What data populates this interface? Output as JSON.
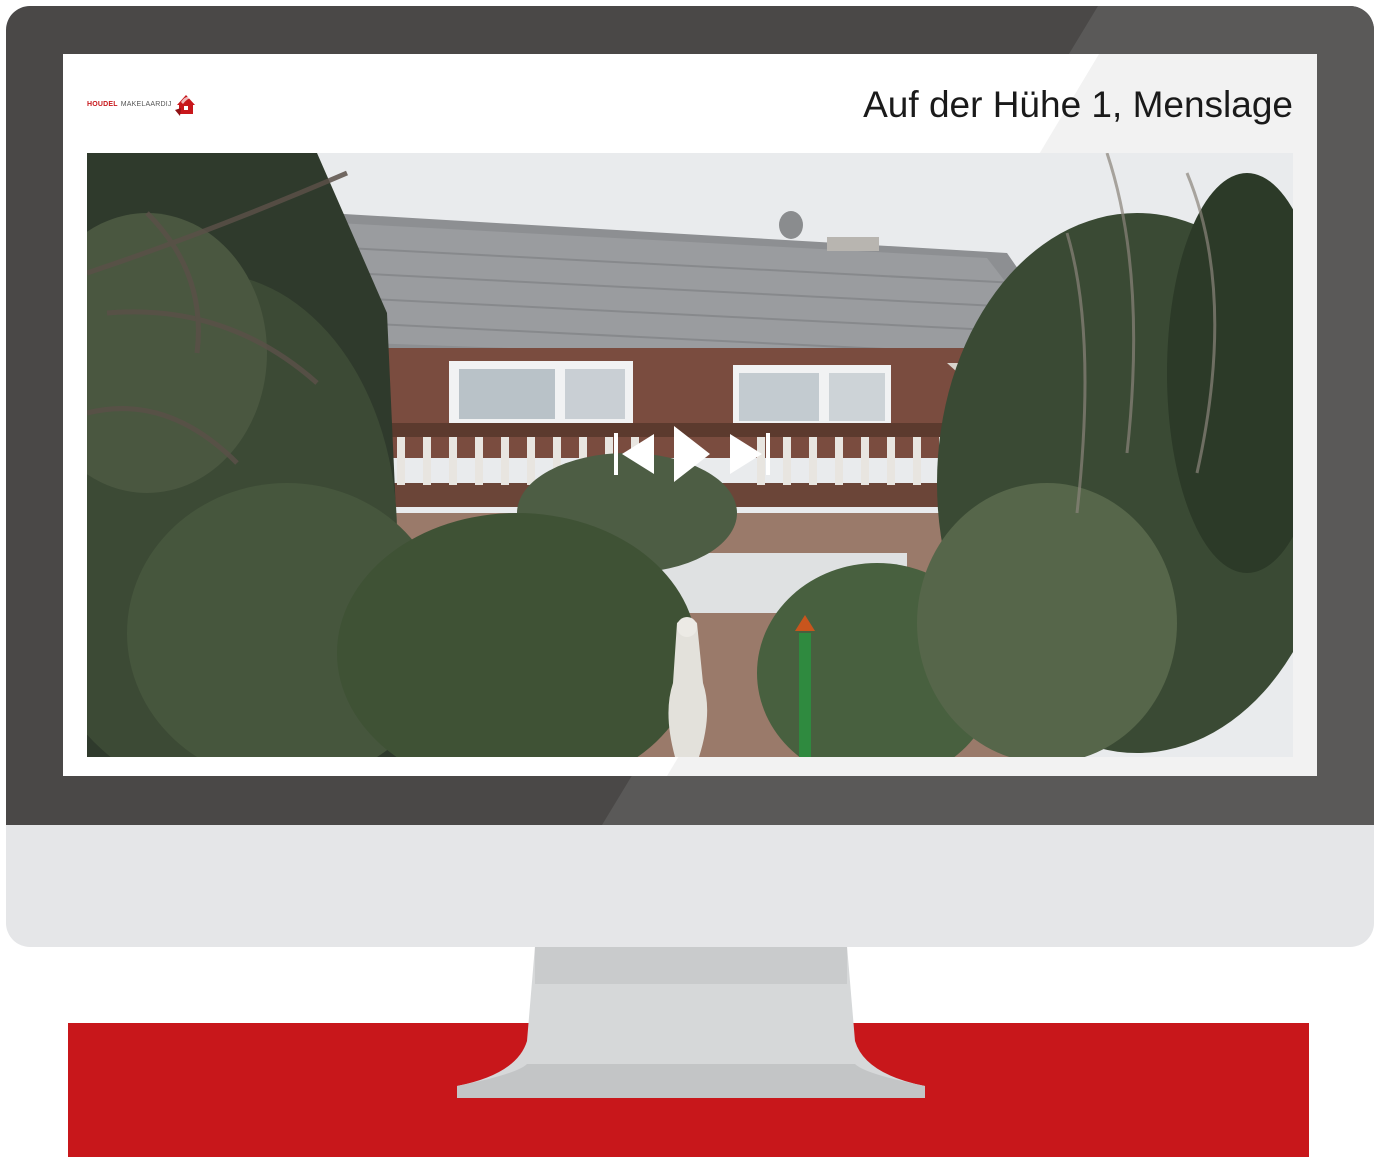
{
  "brand": {
    "name_primary": "HOUDEL",
    "name_secondary": "MAKELAARDIJ",
    "accent_color": "#c8171b"
  },
  "listing": {
    "address": "Auf der Hühe 1, Menslage"
  },
  "photo": {
    "description_icon": "house-photo"
  },
  "player": {
    "controls": [
      {
        "icon": "skip-previous-icon"
      },
      {
        "icon": "play-icon"
      },
      {
        "icon": "skip-next-icon"
      }
    ]
  },
  "colors": {
    "bezel": "#4a4847",
    "chin": "#e5e6e8",
    "stand": "#d6d8d9",
    "base_strip": "#c8171b"
  }
}
